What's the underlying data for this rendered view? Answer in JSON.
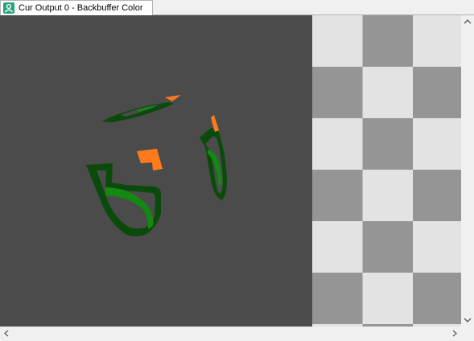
{
  "tab": {
    "label": "Cur Output 0 - Backbuffer Color",
    "icon": "texture-viewer-icon"
  },
  "viewport": {
    "background_color": "#4b4b4b",
    "checker_light": "#e3e3e3",
    "checker_dark": "#959595",
    "mesh_dark_green": "#0a4a0a",
    "mesh_green": "#128a12",
    "mesh_orange": "#ff7a1a"
  },
  "scrollbars": {
    "vertical_up_icon": "chevron-up-icon",
    "vertical_down_icon": "chevron-down-icon",
    "horizontal_left_icon": "chevron-left-icon",
    "horizontal_right_icon": "chevron-right-icon"
  }
}
